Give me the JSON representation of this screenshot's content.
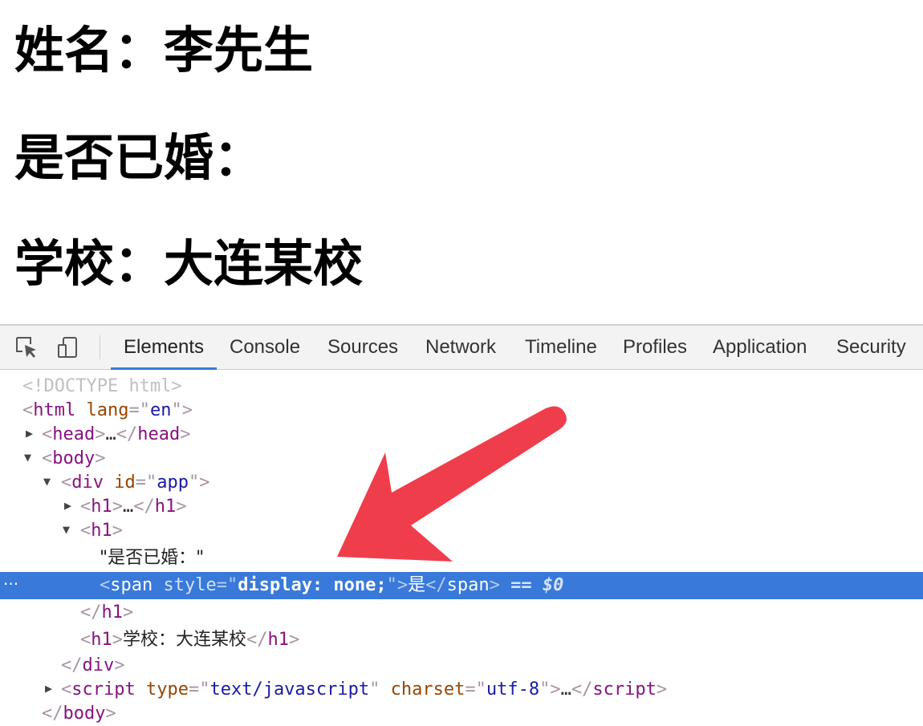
{
  "page": {
    "name_line": "姓名：李先生",
    "married_line": "是否已婚：",
    "school_line": "学校：大连某校"
  },
  "devtools": {
    "tabs": [
      "Elements",
      "Console",
      "Sources",
      "Network",
      "Timeline",
      "Profiles",
      "Application",
      "Security"
    ],
    "active_tab": "Elements",
    "icons": [
      "inspect-element-icon",
      "device-toolbar-icon"
    ],
    "accent_color": "#3879d9",
    "annotation_color": "#f03d4b",
    "tree": {
      "doctype": "<!DOCTYPE html>",
      "html_tag": "html",
      "lang_attr": "lang",
      "lang_val": "en",
      "head_tag": "head",
      "body_tag": "body",
      "div_tag": "div",
      "id_attr": "id",
      "id_val": "app",
      "h1_tag": "h1",
      "ellipsis": "…",
      "h1_text": "\"是否已婚：\"",
      "span_tag": "span",
      "style_attr": "style",
      "style_val": "display: none;",
      "span_text": "是",
      "dollar_ref": "== $0",
      "h1_school_text": "学校：大连某校",
      "script_tag": "script",
      "type_attr": "type",
      "type_val": "text/javascript",
      "charset_attr": "charset",
      "charset_val": "utf-8",
      "more_icon": "···"
    }
  }
}
